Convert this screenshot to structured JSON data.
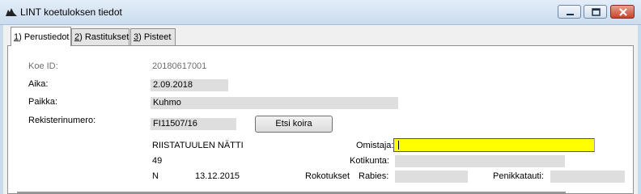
{
  "window": {
    "title": "LINT koetuloksen tiedot",
    "accent": "#c8442b"
  },
  "tabs": [
    {
      "key": "1",
      "rest": ") Perustiedot",
      "active": true
    },
    {
      "key": "2",
      "rest": ") Rastitukset",
      "active": false
    },
    {
      "key": "3",
      "rest": ") Pisteet",
      "active": false
    }
  ],
  "form": {
    "koe_id_label": "Koe ID:",
    "koe_id_value": "20180617001",
    "aika_label": "Aika:",
    "aika_value": "2.09.2018",
    "paikka_label": "Paikka:",
    "paikka_value": "Kuhmo",
    "rekisterinumero_label": "Rekisterinumero:",
    "rekisterinumero_value": "FI11507/16",
    "etsi_koira_label": "Etsi koira",
    "dog_name": "RIISTATUULEN NÄTTI",
    "dog_number": "49",
    "dog_sex": "N",
    "dog_birthdate": "13.12.2015",
    "omistaja_label": "Omistaja:",
    "omistaja_value": "",
    "kotikunta_label": "Kotikunta:",
    "kotikunta_value": "",
    "rokotukset_label": "Rokotukset",
    "rabies_label": "Rabies:",
    "rabies_value": "",
    "penikkatauti_label": "Penikkatauti:",
    "penikkatauti_value": ""
  }
}
